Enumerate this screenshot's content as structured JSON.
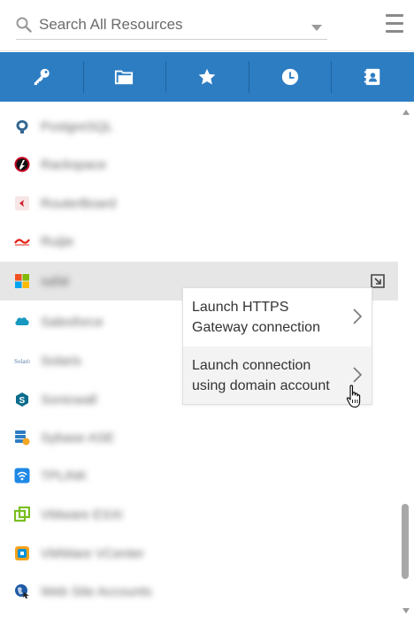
{
  "search": {
    "placeholder": "Search All Resources",
    "search_icon": "search-icon",
    "dropdown_icon": "caret-down-icon"
  },
  "header": {
    "menu_icon": "hamburger-menu-icon"
  },
  "tabs": [
    {
      "icon": "key-icon",
      "active": true
    },
    {
      "icon": "folder-icon",
      "active": false
    },
    {
      "icon": "star-icon",
      "active": false
    },
    {
      "icon": "clock-icon",
      "active": false
    },
    {
      "icon": "contact-card-icon",
      "active": false
    }
  ],
  "resources": [
    {
      "name": "PostgreSQL",
      "icon": "postgresql-logo",
      "color": "#336791"
    },
    {
      "name": "Rackspace",
      "icon": "rackspace-logo",
      "color": "#c40022"
    },
    {
      "name": "RouterBoard",
      "icon": "mikrotik-logo",
      "color": "#d0202f"
    },
    {
      "name": "Ruijie",
      "icon": "ruijie-logo",
      "color": "#e2231a"
    },
    {
      "name": "safal",
      "icon": "windows-logo",
      "color": "#f25022",
      "selected": true
    },
    {
      "name": "Salesforce",
      "icon": "salesforce-logo",
      "color": "#1798c1"
    },
    {
      "name": "Solaris",
      "icon": "solaris-logo",
      "color": "#5a7fa8"
    },
    {
      "name": "Sonicwall",
      "icon": "sonicwall-logo",
      "color": "#0a6c8c"
    },
    {
      "name": "Sybase ASE",
      "icon": "database-logo",
      "color": "#2d7dc3"
    },
    {
      "name": "TPLINK",
      "icon": "wifi-logo",
      "color": "#1e88e5"
    },
    {
      "name": "VMware ESXi",
      "icon": "vmware-logo",
      "color": "#78be20"
    },
    {
      "name": "VMWare VCenter",
      "icon": "vcenter-logo",
      "color": "#0091da"
    },
    {
      "name": "Web Site Accounts",
      "icon": "globe-logo",
      "color": "#1f5aa6"
    }
  ],
  "context_menu": {
    "items": [
      {
        "label": "Launch HTTPS Gateway connection"
      },
      {
        "label": "Launch connection using domain account"
      }
    ]
  },
  "colors": {
    "accent": "#2d7dc3",
    "selected_row": "#e6e6e6"
  }
}
